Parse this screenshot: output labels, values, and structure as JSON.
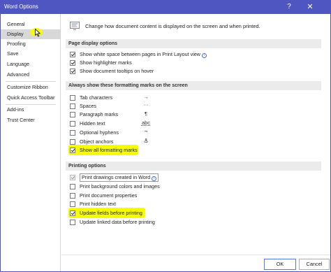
{
  "window": {
    "title": "Word Options",
    "help_glyph": "?",
    "close_glyph": "✕",
    "accent": "#4f55c1"
  },
  "sidebar": {
    "items": [
      {
        "label": "General"
      },
      {
        "label": "Display",
        "selected": true
      },
      {
        "label": "Proofing"
      },
      {
        "label": "Save"
      },
      {
        "label": "Language"
      },
      {
        "label": "Advanced"
      },
      {
        "label": "Customize Ribbon"
      },
      {
        "label": "Quick Access Toolbar"
      },
      {
        "label": "Add-ins"
      },
      {
        "label": "Trust Center"
      }
    ]
  },
  "main": {
    "intro": "Change how document content is displayed on the screen and when printed.",
    "sections": {
      "page_display": "Page display options",
      "formatting_marks": "Always show these formatting marks on the screen",
      "printing": "Printing options"
    },
    "page_display_options": [
      {
        "label": "Show white space between pages in Print Layout view",
        "checked": true,
        "info": "i"
      },
      {
        "label": "Show highlighter marks",
        "checked": true
      },
      {
        "label": "Show document tooltips on hover",
        "checked": true
      }
    ],
    "formatting_marks": [
      {
        "label": "Tab characters",
        "checked": false,
        "symbol": "→"
      },
      {
        "label": "Spaces",
        "checked": false,
        "symbol": "···"
      },
      {
        "label": "Paragraph marks",
        "checked": false,
        "symbol": "¶"
      },
      {
        "label": "Hidden text",
        "checked": false,
        "symbol": "abc"
      },
      {
        "label": "Optional hyphens",
        "checked": false,
        "symbol": "¬"
      },
      {
        "label": "Object anchors",
        "checked": false,
        "symbol": "⚓"
      },
      {
        "label": "Show all formatting marks",
        "checked": true,
        "highlighted": true
      }
    ],
    "printing_options": [
      {
        "label": "Print drawings created in Word",
        "checked": true,
        "disabled": true,
        "info": "i"
      },
      {
        "label": "Print background colors and images",
        "checked": false
      },
      {
        "label": "Print document properties",
        "checked": false
      },
      {
        "label": "Print hidden text",
        "checked": false
      },
      {
        "label": "Update fields before printing",
        "checked": true,
        "highlighted": true
      },
      {
        "label": "Update linked data before printing",
        "checked": false
      }
    ]
  },
  "footer": {
    "ok_label": "OK",
    "cancel_label": "Cancel"
  },
  "colors": {
    "highlight": "#f6ff00",
    "section_bg": "#ebebeb",
    "selected_nav": "#d8d8d8"
  }
}
